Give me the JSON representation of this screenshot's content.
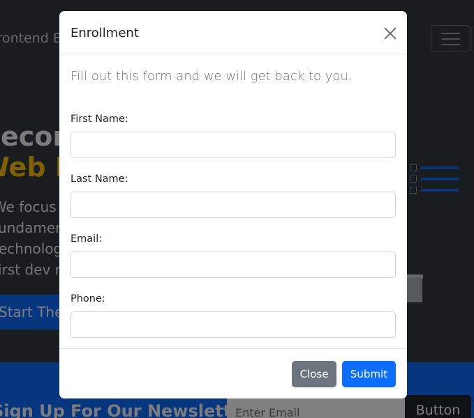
{
  "navbar": {
    "brand": "Frontend Bootcamp"
  },
  "hero": {
    "title": "Become a",
    "accent": "Web Developer",
    "text": "We focus on teaching our students the\nfundamentals of the latest and greatest\ntechnologies to prepare them for their first\nfirst dev role",
    "button_label": "Start The Enrollment"
  },
  "newsletter": {
    "title": "Sign Up For Our Newsletter",
    "email_placeholder": "Enter Email",
    "button_label": "Button"
  },
  "modal": {
    "title": "Enrollment",
    "close_icon": "close-icon",
    "lead": "Fill out this form and we will get back to you.",
    "fields": [
      {
        "label": "First Name:",
        "value": ""
      },
      {
        "label": "Last Name:",
        "value": ""
      },
      {
        "label": "Email:",
        "value": ""
      },
      {
        "label": "Phone:",
        "value": ""
      }
    ],
    "close_label": "Close",
    "submit_label": "Submit"
  },
  "colors": {
    "primary": "#0d6efd",
    "secondary": "#6c757d",
    "accent": "#ffc107",
    "dark": "#343a40"
  }
}
